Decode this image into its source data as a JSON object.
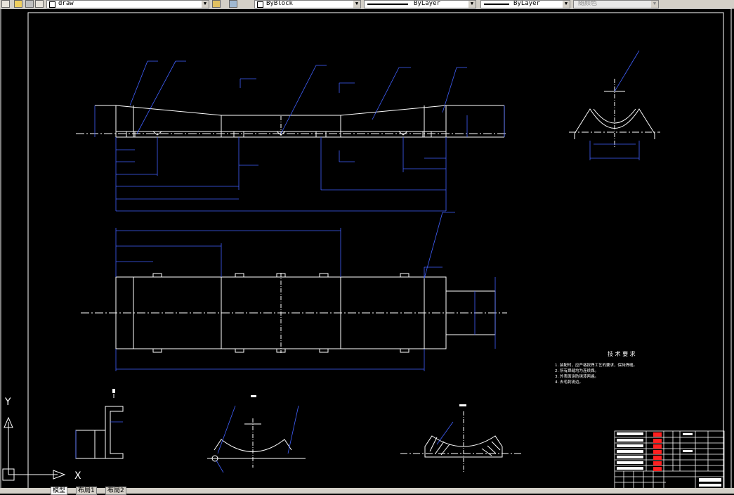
{
  "toolbar": {
    "layer_combo": "draw",
    "linetype_block": "ByBlock",
    "linetype": "ByLayer",
    "lineweight": "ByLayer",
    "plot_style": "随颜色"
  },
  "tech_requirements": {
    "title": "技 术 要 求",
    "items": [
      "1. 装配时，应严格按焊工艺的要求，保持焊缝。",
      "2. 所有焊缝均为连续焊。",
      "3. 外表面涂防锈漆两遍。",
      "4. 去毛刺锐边。"
    ]
  },
  "ucs": {
    "x": "X",
    "y": "Y"
  },
  "tabs": [
    "模型",
    "布局1",
    "布局2"
  ]
}
